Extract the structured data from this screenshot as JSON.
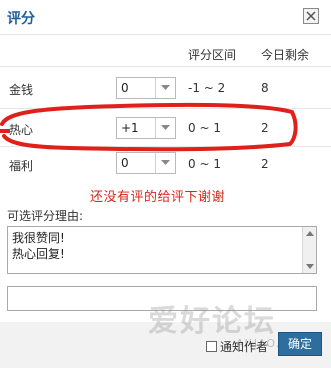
{
  "dialog": {
    "title": "评分",
    "close_icon": "close-icon"
  },
  "columns": {
    "range": "评分区间",
    "today_remaining": "今日剩余"
  },
  "rows": [
    {
      "label": "金钱",
      "value": "0",
      "range": "-1 ~ 2",
      "today": "8"
    },
    {
      "label": "热心",
      "value": "+1",
      "range": "0 ~ 1",
      "today": "2"
    },
    {
      "label": "福利",
      "value": "0",
      "range": "0 ~ 1",
      "today": "2"
    }
  ],
  "annotation": {
    "text": "还没有评的给评下谢谢",
    "color": "#d8261c"
  },
  "reason": {
    "label": "可选评分理由:",
    "options": [
      "我很赞同!",
      "热心回复!"
    ],
    "input_value": ""
  },
  "footer": {
    "notify_label": "通知作者",
    "notify_checked": false,
    "ok_label": "确定"
  },
  "watermark": {
    "text": "爱好论坛",
    "sub": "AIHAO.CC"
  },
  "colors": {
    "title": "#1b5e9b",
    "button": "#2d6e9e"
  }
}
